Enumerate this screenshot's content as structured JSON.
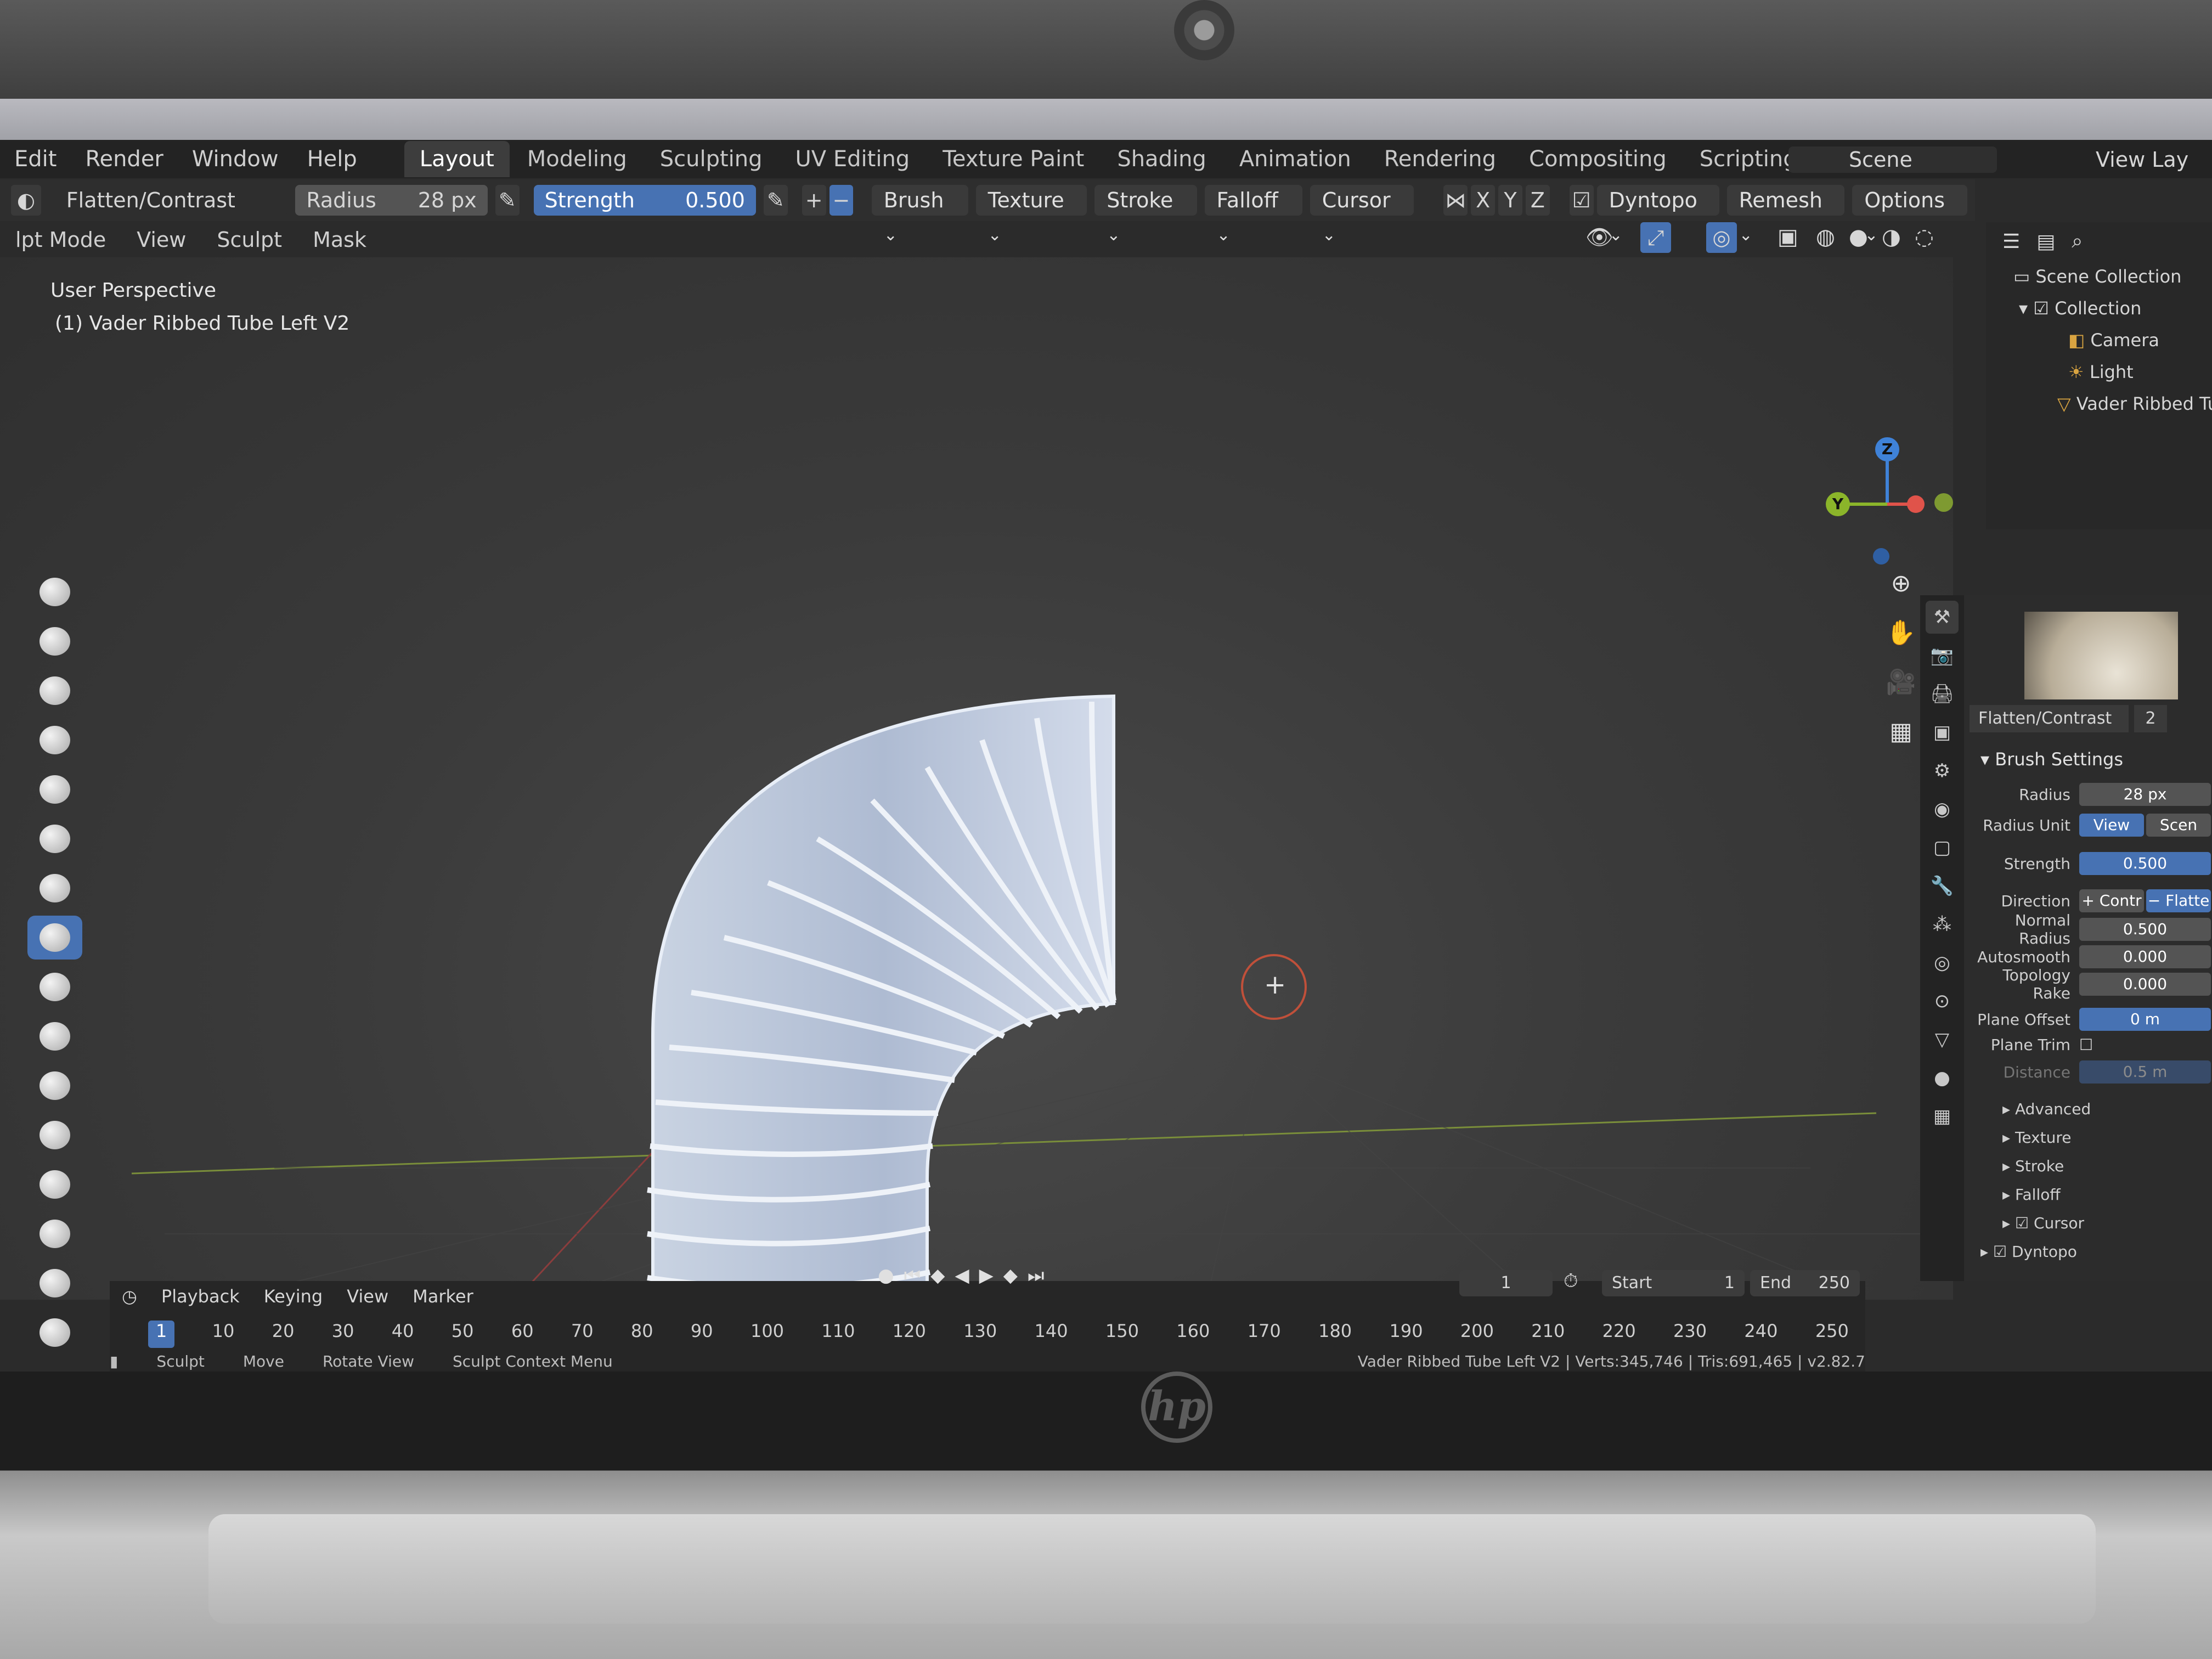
{
  "topbar": {
    "menus": [
      "Edit",
      "Render",
      "Window",
      "Help"
    ],
    "workspaces": [
      "Layout",
      "Modeling",
      "Sculpting",
      "UV Editing",
      "Texture Paint",
      "Shading",
      "Animation",
      "Rendering",
      "Compositing",
      "Scripting"
    ],
    "active_workspace": "Layout",
    "add_tab": "+",
    "scene": "Scene",
    "view_layer": "View Lay"
  },
  "toolbar": {
    "brush_name": "Flatten/Contrast",
    "radius_label": "Radius",
    "radius_value": "28 px",
    "strength_label": "Strength",
    "strength_value": "0.500",
    "plus": "+",
    "minus": "−",
    "dropdowns": [
      "Brush",
      "Texture",
      "Stroke",
      "Falloff",
      "Cursor"
    ],
    "axes": [
      "X",
      "Y",
      "Z"
    ],
    "dyntopo": "Dyntopo",
    "remesh": "Remesh",
    "options": "Options"
  },
  "header": {
    "mode": "lpt Mode",
    "menus": [
      "View",
      "Sculpt",
      "Mask"
    ]
  },
  "viewport": {
    "perspective": "User Perspective",
    "object_label": "(1) Vader Ribbed Tube Left V2",
    "gizmo": {
      "z": "Z",
      "y": "Y"
    }
  },
  "timeline": {
    "menus": [
      "Playback",
      "Keying",
      "View",
      "Marker"
    ],
    "current_frame": "1",
    "start_label": "Start",
    "start_value": "1",
    "end_label": "End",
    "end_value": "250",
    "ticks": [
      "1",
      "10",
      "20",
      "30",
      "40",
      "50",
      "60",
      "70",
      "80",
      "90",
      "100",
      "110",
      "120",
      "130",
      "140",
      "150",
      "160",
      "170",
      "180",
      "190",
      "200",
      "210",
      "220",
      "230",
      "240",
      "250"
    ]
  },
  "status": {
    "sculpt": "Sculpt",
    "move": "Move",
    "rotate": "Rotate View",
    "context_menu": "Sculpt Context Menu",
    "stats": "Vader Ribbed Tube Left V2 | Verts:345,746 | Tris:691,465 | v2.82.7"
  },
  "outliner": {
    "scene_collection": "Scene Collection",
    "collection": "Collection",
    "items": [
      "Camera",
      "Light",
      "Vader Ribbed Tub"
    ]
  },
  "properties": {
    "brush_name": "Flatten/Contrast",
    "brush_users": "2",
    "section": "Brush Settings",
    "rows": [
      {
        "label": "Radius",
        "value": "28 px"
      },
      {
        "label": "Radius Unit",
        "value": "View"
      },
      {
        "label": "Strength",
        "value": "0.500"
      },
      {
        "label": "Direction",
        "value": "+ Contr"
      },
      {
        "label": "Normal Radius",
        "value": "0.500"
      },
      {
        "label": "Autosmooth",
        "value": "0.000"
      },
      {
        "label": "Topology Rake",
        "value": "0.000"
      },
      {
        "label": "Plane Offset",
        "value": "0 m"
      },
      {
        "label": "Plane Trim",
        "value": ""
      },
      {
        "label": "Distance",
        "value": "0.5 m"
      }
    ],
    "radius_unit_alt": "Scen",
    "direction_alt": "− Flatte",
    "subsections": [
      "Advanced",
      "Texture",
      "Stroke",
      "Falloff",
      "Cursor",
      "Dyntopo"
    ]
  },
  "colors": {
    "accent_blue": "#4772b3",
    "viewport_bg": "#3b3b3b",
    "gizmo_x": "#e0534a",
    "gizmo_y": "#8bb52a",
    "gizmo_z": "#3f82d8"
  }
}
